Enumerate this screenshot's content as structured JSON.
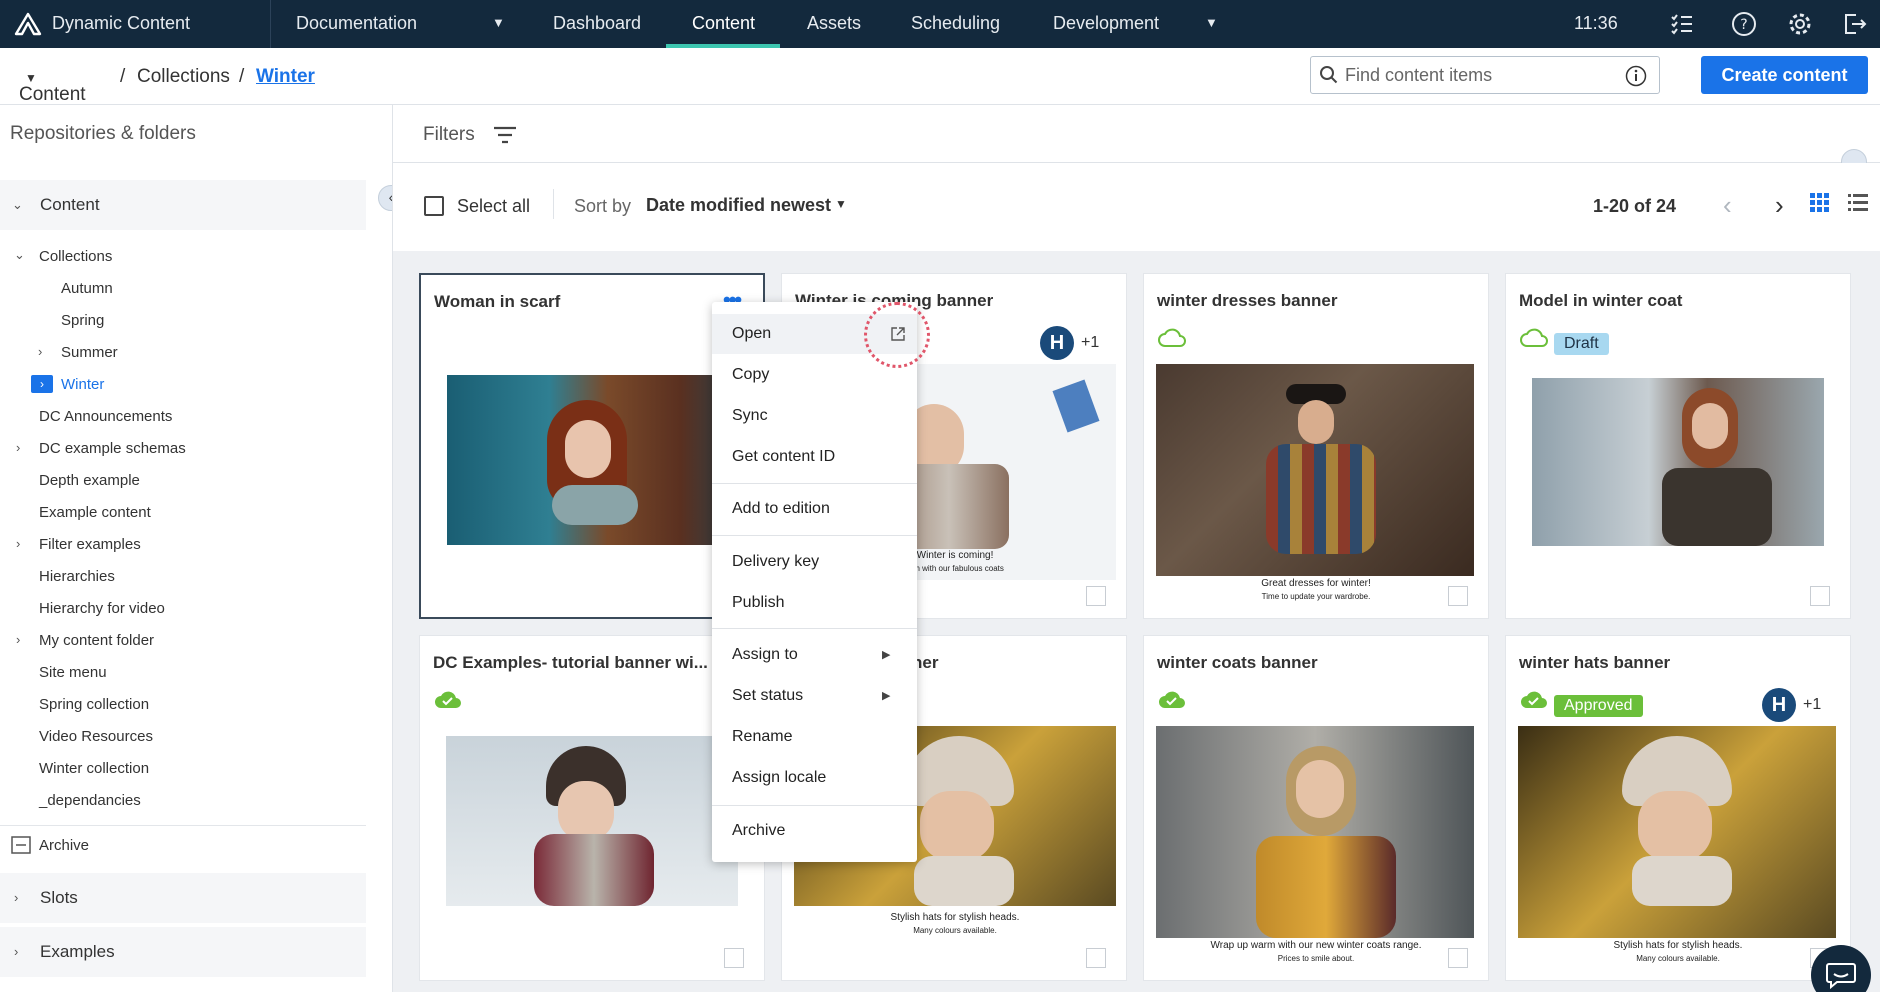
{
  "topnav": {
    "app_name": "Dynamic Content",
    "hub": "Documentation",
    "tabs": [
      "Dashboard",
      "Content",
      "Assets",
      "Scheduling",
      "Development"
    ],
    "active_tab": "Content",
    "time": "11:36"
  },
  "breadcrumb": {
    "root": "Content",
    "sep1": "/",
    "parent": "Collections",
    "sep2": "/",
    "current": "Winter"
  },
  "search": {
    "placeholder": "Find content items"
  },
  "create_button": "Create content",
  "sidebar": {
    "header": "Repositories & folders",
    "content_section": "Content",
    "collections": "Collections",
    "collection_items": [
      "Autumn",
      "Spring",
      "Summer",
      "Winter"
    ],
    "folders": [
      "DC Announcements",
      "DC example schemas",
      "Depth example",
      "Example content",
      "Filter examples",
      "Hierarchies",
      "Hierarchy for video",
      "My content folder",
      "Site menu",
      "Spring collection",
      "Video Resources",
      "Winter collection",
      "_dependancies"
    ],
    "archive": "Archive",
    "slots": "Slots",
    "examples": "Examples"
  },
  "filters": {
    "label": "Filters"
  },
  "toolbar": {
    "select_all": "Select all",
    "sort_label": "Sort by",
    "sort_value": "Date modified newest",
    "pagination": "1-20 of 24"
  },
  "cards": [
    {
      "title": "Woman in scarf"
    },
    {
      "title": "Winter is coming banner",
      "avatar": "H",
      "extra": "+1",
      "caption1": "Winter is coming!",
      "caption2": "arm with our fabulous coats"
    },
    {
      "title": "winter dresses banner",
      "caption1": "Great dresses for winter!",
      "caption2": "Time to update your wardrobe."
    },
    {
      "title": "Model in winter coat",
      "badge": "Draft"
    },
    {
      "title": "DC Examples- tutorial banner wi..."
    },
    {
      "title": "ner",
      "caption1": "Stylish hats for stylish heads.",
      "caption2": "Many colours available."
    },
    {
      "title": "winter coats banner",
      "caption1": "Wrap up warm with our new winter coats range.",
      "caption2": "Prices to smile about."
    },
    {
      "title": "winter hats banner",
      "badge": "Approved",
      "avatar": "H",
      "extra": "+1",
      "caption1": "Stylish hats for stylish heads.",
      "caption2": "Many colours available."
    }
  ],
  "context_menu": [
    "Open",
    "Copy",
    "Sync",
    "Get content ID",
    "Add to edition",
    "Delivery key",
    "Publish",
    "Assign to",
    "Set status",
    "Rename",
    "Assign locale",
    "Archive"
  ],
  "colors": {
    "nav_bg": "#13293d",
    "accent": "#1a73e8",
    "active_underline": "#3dc6b0",
    "draft_badge": "#a8d8f0",
    "approved_badge": "#6bbf3a"
  }
}
